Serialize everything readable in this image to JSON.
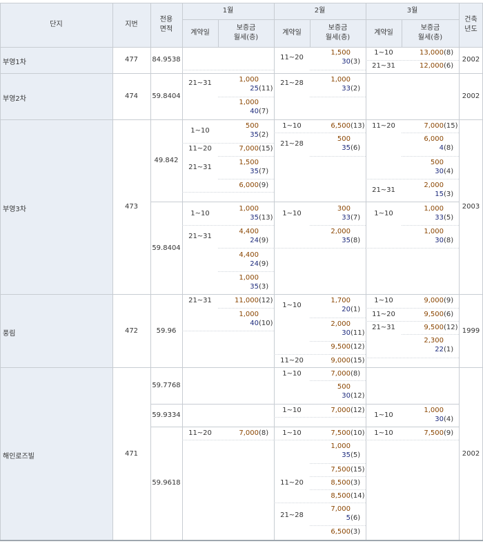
{
  "header": {
    "complex": "단지",
    "lot": "지번",
    "area_l1": "전용",
    "area_l2": "면적",
    "months": [
      "1월",
      "2월",
      "3월"
    ],
    "date": "계약일",
    "price_l1": "보증금",
    "price_l2": "월세(층)",
    "built_l1": "건축",
    "built_l2": "년도"
  },
  "complexes": [
    {
      "name": "부영1차",
      "lot": "477",
      "built": "2002",
      "areas": [
        "84.9538"
      ]
    },
    {
      "name": "부영2차",
      "lot": "474",
      "built": "2002",
      "areas": [
        "59.8404"
      ]
    },
    {
      "name": "부영3차",
      "lot": "473",
      "built": "2003",
      "areas": [
        "49.842",
        "59.8404"
      ]
    },
    {
      "name": "풍림",
      "lot": "472",
      "built": "1999",
      "areas": [
        "59.96"
      ]
    },
    {
      "name": "해인로즈빌",
      "lot": "471",
      "built": "2002",
      "areas": [
        "59.7768",
        "59.9334",
        "59.9618"
      ]
    }
  ],
  "dates": {
    "b1_m2": "11~20",
    "b1_m3_a": "1~10",
    "b1_m3_b": "21~31",
    "b2_m1": "21~31",
    "b2_m2": "21~28",
    "b3a_m1_a": "1~10",
    "b3a_m1_b": "11~20",
    "b3a_m1_c": "21~31",
    "b3a_m2_a": "1~10",
    "b3a_m2_b": "21~28",
    "b3a_m3_a": "11~20",
    "b3a_m3_b": "21~31",
    "b3b_m1_a": "1~10",
    "b3b_m1_b": "21~31",
    "b3b_m2_a": "1~10",
    "b3b_m3_a": "1~10",
    "p_m1": "21~31",
    "p_m2_a": "1~10",
    "p_m2_b": "11~20",
    "p_m3_a": "1~10",
    "p_m3_b": "11~20",
    "p_m3_c": "21~31",
    "h1_m2": "1~10",
    "h2_m2": "1~10",
    "h2_m3": "1~10",
    "h3_m1": "11~20",
    "h3_m2_a": "1~10",
    "h3_m2_b": "11~20",
    "h3_m2_c": "21~28",
    "h3_m3": "1~10"
  },
  "prices": {
    "b1_m2": {
      "deposit": "1,500",
      "rent": "30",
      "floor": "(3)"
    },
    "b1_m3_a": {
      "deposit": "13,000",
      "floor": "(8)"
    },
    "b1_m3_b": {
      "deposit": "12,000",
      "floor": "(6)"
    },
    "b2_m1_a": {
      "deposit": "1,000",
      "rent": "25",
      "floor": "(11)"
    },
    "b2_m1_b": {
      "deposit": "1,000",
      "rent": "40",
      "floor": "(7)"
    },
    "b2_m2": {
      "deposit": "1,000",
      "rent": "33",
      "floor": "(2)"
    },
    "b3a_m1_a": {
      "deposit": "500",
      "rent": "35",
      "floor": "(2)"
    },
    "b3a_m1_b": {
      "deposit": "7,000",
      "floor": "(15)"
    },
    "b3a_m1_c": {
      "deposit": "1,500",
      "rent": "35",
      "floor": "(7)"
    },
    "b3a_m1_d": {
      "deposit": "6,000",
      "floor": "(9)"
    },
    "b3a_m2_a": {
      "deposit": "6,500",
      "floor": "(13)"
    },
    "b3a_m2_b": {
      "deposit": "500",
      "rent": "35",
      "floor": "(6)"
    },
    "b3a_m3_a": {
      "deposit": "7,000",
      "floor": "(15)"
    },
    "b3a_m3_b": {
      "deposit": "6,000",
      "rent": "4",
      "floor": "(8)"
    },
    "b3a_m3_c": {
      "deposit": "500",
      "rent": "30",
      "floor": "(4)"
    },
    "b3a_m3_d": {
      "deposit": "2,000",
      "rent": "15",
      "floor": "(3)"
    },
    "b3b_m1_a": {
      "deposit": "1,000",
      "rent": "35",
      "floor": "(13)"
    },
    "b3b_m1_b": {
      "deposit": "4,400",
      "rent": "24",
      "floor": "(9)"
    },
    "b3b_m1_c": {
      "deposit": "4,400",
      "rent": "24",
      "floor": "(9)"
    },
    "b3b_m1_d": {
      "deposit": "1,000",
      "rent": "35",
      "floor": "(3)"
    },
    "b3b_m2_a": {
      "deposit": "300",
      "rent": "33",
      "floor": "(7)"
    },
    "b3b_m2_b": {
      "deposit": "2,000",
      "rent": "35",
      "floor": "(8)"
    },
    "b3b_m3_a": {
      "deposit": "1,000",
      "rent": "33",
      "floor": "(5)"
    },
    "b3b_m3_b": {
      "deposit": "1,000",
      "rent": "30",
      "floor": "(8)"
    },
    "p_m1_a": {
      "deposit": "11,000",
      "floor": "(12)"
    },
    "p_m1_b": {
      "deposit": "1,000",
      "rent": "40",
      "floor": "(10)"
    },
    "p_m2_a": {
      "deposit": "1,700",
      "rent": "20",
      "floor": "(1)"
    },
    "p_m2_b": {
      "deposit": "2,000",
      "rent": "30",
      "floor": "(11)"
    },
    "p_m2_c": {
      "deposit": "9,500",
      "floor": "(12)"
    },
    "p_m2_d": {
      "deposit": "9,000",
      "floor": "(15)"
    },
    "p_m3_a": {
      "deposit": "9,000",
      "floor": "(9)"
    },
    "p_m3_b": {
      "deposit": "9,500",
      "floor": "(6)"
    },
    "p_m3_c": {
      "deposit": "9,500",
      "floor": "(12)"
    },
    "p_m3_d": {
      "deposit": "2,300",
      "rent": "22",
      "floor": "(1)"
    },
    "h1_m2_a": {
      "deposit": "7,000",
      "floor": "(8)"
    },
    "h1_m2_b": {
      "deposit": "500",
      "rent": "30",
      "floor": "(12)"
    },
    "h2_m2": {
      "deposit": "7,000",
      "floor": "(12)"
    },
    "h2_m3": {
      "deposit": "1,000",
      "rent": "30",
      "floor": "(4)"
    },
    "h3_m1": {
      "deposit": "7,000",
      "floor": "(8)"
    },
    "h3_m2_a": {
      "deposit": "7,500",
      "floor": "(10)"
    },
    "h3_m2_b": {
      "deposit": "1,000",
      "rent": "35",
      "floor": "(5)"
    },
    "h3_m2_c": {
      "deposit": "7,500",
      "floor": "(15)"
    },
    "h3_m2_d": {
      "deposit": "8,500",
      "floor": "(3)"
    },
    "h3_m2_e": {
      "deposit": "8,500",
      "floor": "(14)"
    },
    "h3_m2_f": {
      "deposit": "7,000",
      "rent": "5",
      "floor": "(6)"
    },
    "h3_m2_g": {
      "deposit": "6,500",
      "floor": "(3)"
    },
    "h3_m3": {
      "deposit": "7,500",
      "floor": "(9)"
    }
  },
  "colors": {
    "header_bg": "#e9eef5",
    "deposit": "#8a4500",
    "rent": "#1c2a7c",
    "grid": "#c7ccd2"
  }
}
